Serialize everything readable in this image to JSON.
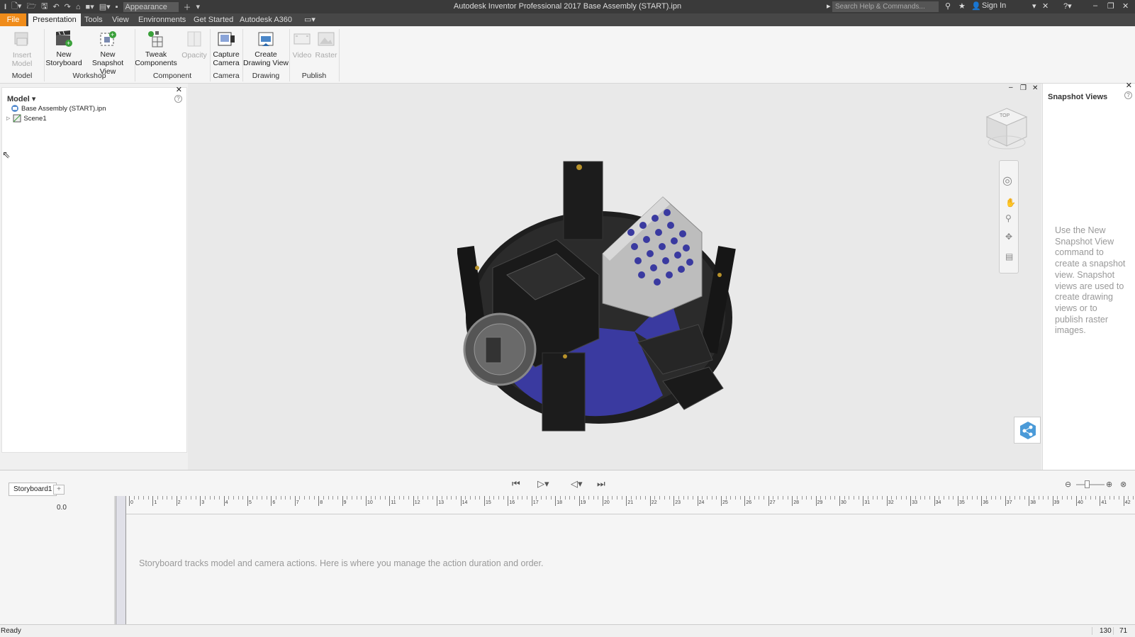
{
  "titlebar": {
    "appearance_placeholder": "Appearance",
    "title": "Autodesk Inventor Professional 2017    Base Assembly (START).ipn",
    "search_placeholder": "Search Help & Commands...",
    "sign_in": "Sign In"
  },
  "ribbon_tabs": [
    "File",
    "Presentation",
    "Tools",
    "View",
    "Environments",
    "Get Started",
    "Autodesk A360"
  ],
  "ribbon": {
    "insert_model": "Insert Model",
    "new_storyboard": [
      "New",
      "Storyboard"
    ],
    "new_snapshot_view": [
      "New",
      "Snapshot View"
    ],
    "tweak_components": [
      "Tweak",
      "Components"
    ],
    "opacity": "Opacity",
    "capture_camera": [
      "Capture",
      "Camera"
    ],
    "create_drawing_view": [
      "Create",
      "Drawing View"
    ],
    "video": "Video",
    "raster": "Raster",
    "groups": [
      "Model",
      "Workshop",
      "Component",
      "Camera",
      "Drawing",
      "Publish"
    ]
  },
  "browser": {
    "title": "Model",
    "items": [
      "Base Assembly (START).ipn",
      "Scene1"
    ]
  },
  "snapshots": {
    "title": "Snapshot Views",
    "hint": "Use the New Snapshot View command to create a snapshot view. Snapshot views are used to create drawing views or to publish raster images."
  },
  "viewcube": {
    "face": "TOP"
  },
  "storyboard": {
    "tab": "Storyboard1",
    "time": "0.0",
    "hint": "Storyboard tracks model and camera actions. Here is where you manage the action duration and order.",
    "ruler_labels": [
      "0",
      "1",
      "2",
      "3",
      "4",
      "5",
      "6",
      "7",
      "8",
      "9",
      "10",
      "11",
      "12",
      "13",
      "14",
      "15",
      "16",
      "17",
      "18",
      "19",
      "20",
      "21",
      "22",
      "23",
      "24",
      "25",
      "26",
      "27",
      "28",
      "29",
      "30",
      "31",
      "32",
      "33",
      "34",
      "35",
      "36",
      "37",
      "38",
      "39",
      "40",
      "41",
      "42"
    ]
  },
  "status": {
    "text": "Ready",
    "value_a": "130",
    "value_b": "71"
  },
  "colors": {
    "accent": "#f08c1a",
    "model_blue": "#3a3aa0"
  }
}
